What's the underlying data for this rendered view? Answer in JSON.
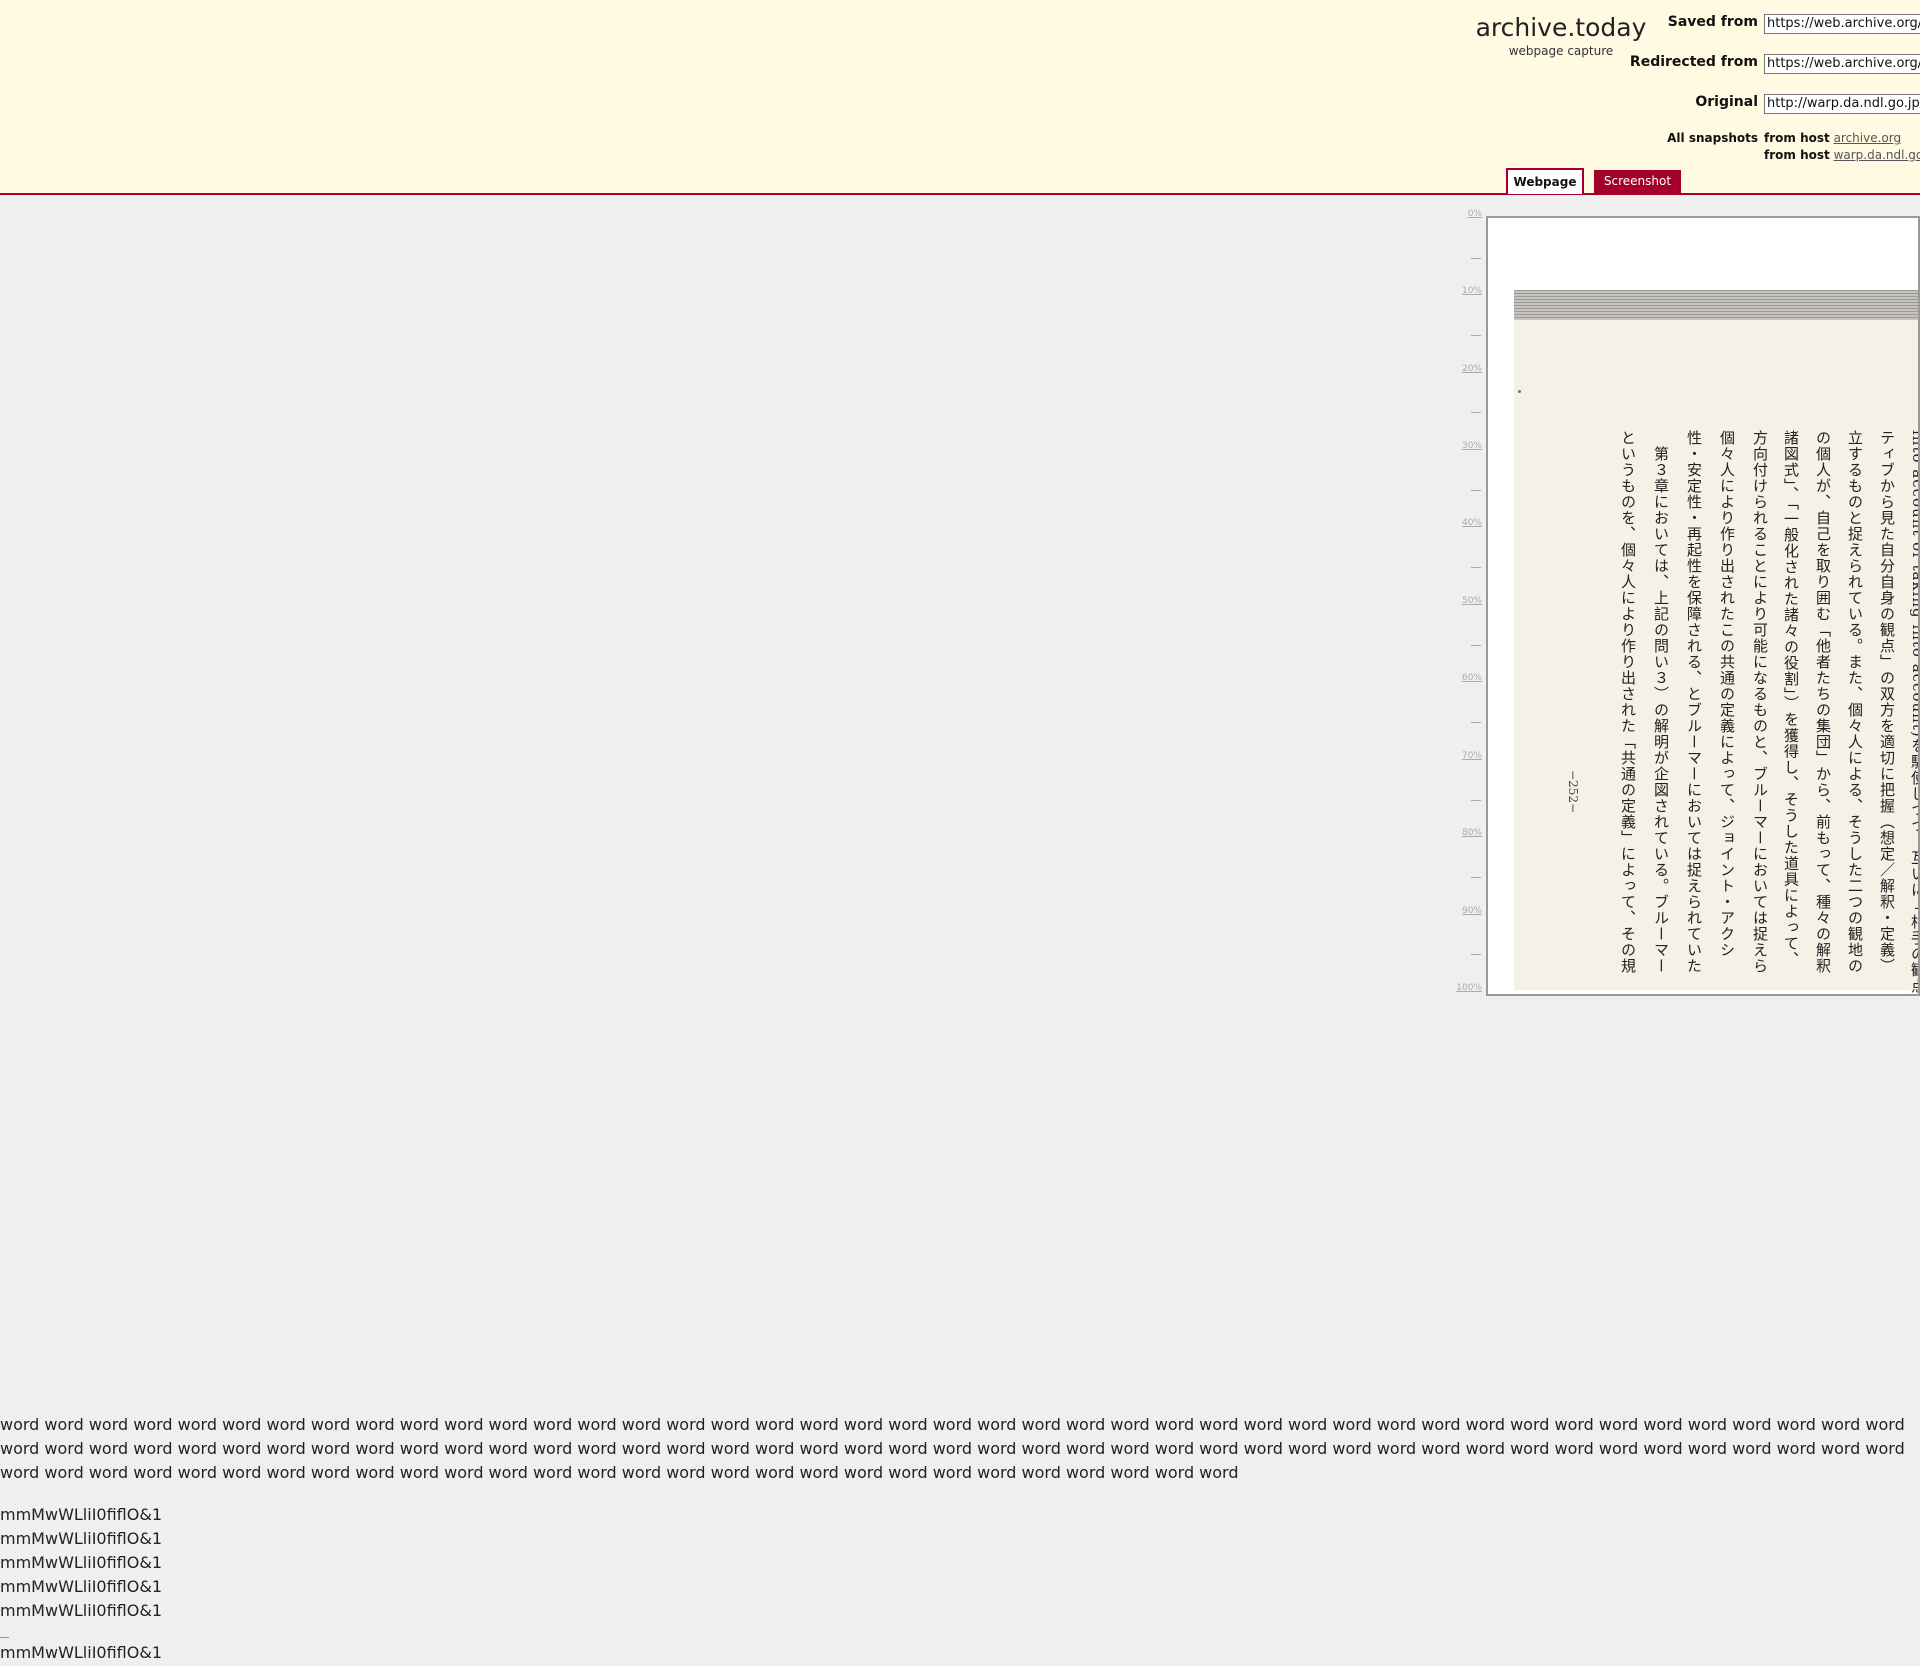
{
  "header": {
    "brand_title": "archive.today",
    "brand_subtitle": "webpage capture",
    "saved_from_label": "Saved from",
    "saved_from_value": "https://web.archive.org/web/",
    "redirected_from_label": "Redirected from",
    "redirected_from_value": "https://web.archive.org/web/",
    "original_label": "Original",
    "original_value": "http://warp.da.ndl.go.jp/",
    "all_snapshots_label": "All snapshots",
    "snapshots": [
      {
        "prefix": "from host",
        "host": "archive.org"
      },
      {
        "prefix": "from host",
        "host": "warp.da.ndl.go.jp"
      }
    ],
    "tabs": {
      "webpage": "Webpage",
      "screenshot": "Screenshot"
    },
    "accent_color": "#a5002c",
    "background_color": "#fffae1"
  },
  "scale": [
    "0%",
    "10%",
    "20%",
    "30%",
    "40%",
    "50%",
    "60%",
    "70%",
    "80%",
    "90%",
    "100%"
  ],
  "document": {
    "columns": [
      "into account of taking into account)を駆使しつつ、互いに「相手の観点」と「",
      "ティブから見た自分自身の観点」の双方を適切に把握（想定／解釈・定義）",
      "立するものと捉えられている。また、個々人による、そうした二つの観地の",
      "の個人が、自己を取り囲む「他者たちの集団」から、前もって、種々の解釈",
      "諸図式」、「一般化された諸々の役割」）を獲得し、そうした道具によって、",
      "方向付けられることにより可能になるものと、ブルーマーにおいては捉えら",
      "個々人により作り出されたこの共通の定義によって、ジョイント・アクシ",
      "性・安定性・再起性を保障される、とブルーマーにおいては捉えられていた",
      "　第３章においては、上記の問い３）の解明が企図されている。ブルーマー",
      "というものを、個々人により作り出された「共通の定義」によって、その規"
    ],
    "page_number": "−252−"
  },
  "body_text": {
    "words": "word word word word word word word word word word word word word word word word word word word word word word word word word word word word word word word word word word word word word word word word word word word word word word word word word word word word word word word word word word word word word word word word word word word word word word word word word word word word word word word word word word word word word word word word word word word word word word word word word word word word word word word word word word word word word word word word word word",
    "test_lines": [
      "mmMwWLliI0fiflO&1",
      "mmMwWLliI0fiflO&1",
      "mmMwWLliI0fiflO&1",
      "mmMwWLliI0fiflO&1",
      "mmMwWLliI0fiflO&1",
      "mmMwWLliI0fiflO&1"
    ]
  }
}
